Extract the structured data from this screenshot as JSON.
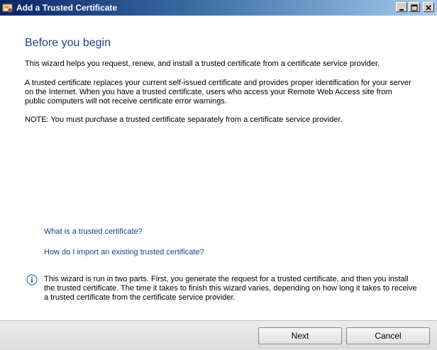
{
  "window": {
    "title": "Add a Trusted Certificate",
    "title_icon": "certificate-icon"
  },
  "title_buttons": {
    "minimize_icon": "minimize-icon",
    "maximize_icon": "maximize-icon",
    "close_icon": "close-icon"
  },
  "content": {
    "heading": "Before you begin",
    "paragraph1": "This wizard helps you request, renew, and install a trusted certificate from a certificate service provider.",
    "paragraph2": "A trusted certificate replaces your current self-issued certificate and provides proper identification for your server on the Internet. When you have a trusted certificate, users who access your Remote Web Access site from public computers will not receive certificate error warnings.",
    "paragraph3": "NOTE: You must purchase a trusted certificate separately from a certificate service provider.",
    "link1": "What is a trusted certificate?",
    "link2": "How do I import an existing trusted certificate?",
    "info_icon": "info-icon",
    "info_text": "This wizard is run in two parts. First, you generate the request for a trusted certificate, and then you install the trusted certificate. The time it takes to finish this wizard varies, depending on how long it takes to receive a trusted certificate from the certificate service provider."
  },
  "footer": {
    "next_label": "Next",
    "cancel_label": "Cancel"
  },
  "colors": {
    "heading": "#1e3d8f",
    "link": "#1a3c96",
    "titlebar_start": "#0a246a",
    "titlebar_end": "#a6caf0"
  }
}
